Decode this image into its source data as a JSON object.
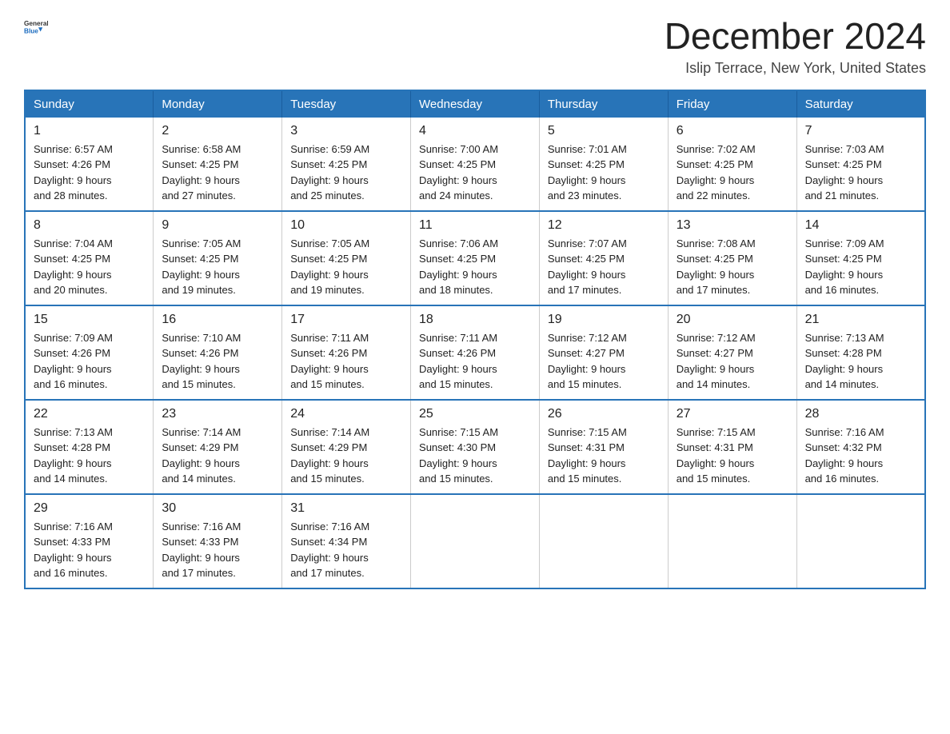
{
  "header": {
    "logo_general": "General",
    "logo_blue": "Blue",
    "title": "December 2024",
    "subtitle": "Islip Terrace, New York, United States"
  },
  "weekdays": [
    "Sunday",
    "Monday",
    "Tuesday",
    "Wednesday",
    "Thursday",
    "Friday",
    "Saturday"
  ],
  "weeks": [
    [
      {
        "day": "1",
        "sunrise": "6:57 AM",
        "sunset": "4:26 PM",
        "daylight": "9 hours and 28 minutes."
      },
      {
        "day": "2",
        "sunrise": "6:58 AM",
        "sunset": "4:25 PM",
        "daylight": "9 hours and 27 minutes."
      },
      {
        "day": "3",
        "sunrise": "6:59 AM",
        "sunset": "4:25 PM",
        "daylight": "9 hours and 25 minutes."
      },
      {
        "day": "4",
        "sunrise": "7:00 AM",
        "sunset": "4:25 PM",
        "daylight": "9 hours and 24 minutes."
      },
      {
        "day": "5",
        "sunrise": "7:01 AM",
        "sunset": "4:25 PM",
        "daylight": "9 hours and 23 minutes."
      },
      {
        "day": "6",
        "sunrise": "7:02 AM",
        "sunset": "4:25 PM",
        "daylight": "9 hours and 22 minutes."
      },
      {
        "day": "7",
        "sunrise": "7:03 AM",
        "sunset": "4:25 PM",
        "daylight": "9 hours and 21 minutes."
      }
    ],
    [
      {
        "day": "8",
        "sunrise": "7:04 AM",
        "sunset": "4:25 PM",
        "daylight": "9 hours and 20 minutes."
      },
      {
        "day": "9",
        "sunrise": "7:05 AM",
        "sunset": "4:25 PM",
        "daylight": "9 hours and 19 minutes."
      },
      {
        "day": "10",
        "sunrise": "7:05 AM",
        "sunset": "4:25 PM",
        "daylight": "9 hours and 19 minutes."
      },
      {
        "day": "11",
        "sunrise": "7:06 AM",
        "sunset": "4:25 PM",
        "daylight": "9 hours and 18 minutes."
      },
      {
        "day": "12",
        "sunrise": "7:07 AM",
        "sunset": "4:25 PM",
        "daylight": "9 hours and 17 minutes."
      },
      {
        "day": "13",
        "sunrise": "7:08 AM",
        "sunset": "4:25 PM",
        "daylight": "9 hours and 17 minutes."
      },
      {
        "day": "14",
        "sunrise": "7:09 AM",
        "sunset": "4:25 PM",
        "daylight": "9 hours and 16 minutes."
      }
    ],
    [
      {
        "day": "15",
        "sunrise": "7:09 AM",
        "sunset": "4:26 PM",
        "daylight": "9 hours and 16 minutes."
      },
      {
        "day": "16",
        "sunrise": "7:10 AM",
        "sunset": "4:26 PM",
        "daylight": "9 hours and 15 minutes."
      },
      {
        "day": "17",
        "sunrise": "7:11 AM",
        "sunset": "4:26 PM",
        "daylight": "9 hours and 15 minutes."
      },
      {
        "day": "18",
        "sunrise": "7:11 AM",
        "sunset": "4:26 PM",
        "daylight": "9 hours and 15 minutes."
      },
      {
        "day": "19",
        "sunrise": "7:12 AM",
        "sunset": "4:27 PM",
        "daylight": "9 hours and 15 minutes."
      },
      {
        "day": "20",
        "sunrise": "7:12 AM",
        "sunset": "4:27 PM",
        "daylight": "9 hours and 14 minutes."
      },
      {
        "day": "21",
        "sunrise": "7:13 AM",
        "sunset": "4:28 PM",
        "daylight": "9 hours and 14 minutes."
      }
    ],
    [
      {
        "day": "22",
        "sunrise": "7:13 AM",
        "sunset": "4:28 PM",
        "daylight": "9 hours and 14 minutes."
      },
      {
        "day": "23",
        "sunrise": "7:14 AM",
        "sunset": "4:29 PM",
        "daylight": "9 hours and 14 minutes."
      },
      {
        "day": "24",
        "sunrise": "7:14 AM",
        "sunset": "4:29 PM",
        "daylight": "9 hours and 15 minutes."
      },
      {
        "day": "25",
        "sunrise": "7:15 AM",
        "sunset": "4:30 PM",
        "daylight": "9 hours and 15 minutes."
      },
      {
        "day": "26",
        "sunrise": "7:15 AM",
        "sunset": "4:31 PM",
        "daylight": "9 hours and 15 minutes."
      },
      {
        "day": "27",
        "sunrise": "7:15 AM",
        "sunset": "4:31 PM",
        "daylight": "9 hours and 15 minutes."
      },
      {
        "day": "28",
        "sunrise": "7:16 AM",
        "sunset": "4:32 PM",
        "daylight": "9 hours and 16 minutes."
      }
    ],
    [
      {
        "day": "29",
        "sunrise": "7:16 AM",
        "sunset": "4:33 PM",
        "daylight": "9 hours and 16 minutes."
      },
      {
        "day": "30",
        "sunrise": "7:16 AM",
        "sunset": "4:33 PM",
        "daylight": "9 hours and 17 minutes."
      },
      {
        "day": "31",
        "sunrise": "7:16 AM",
        "sunset": "4:34 PM",
        "daylight": "9 hours and 17 minutes."
      },
      null,
      null,
      null,
      null
    ]
  ],
  "labels": {
    "sunrise": "Sunrise: ",
    "sunset": "Sunset: ",
    "daylight": "Daylight: "
  }
}
